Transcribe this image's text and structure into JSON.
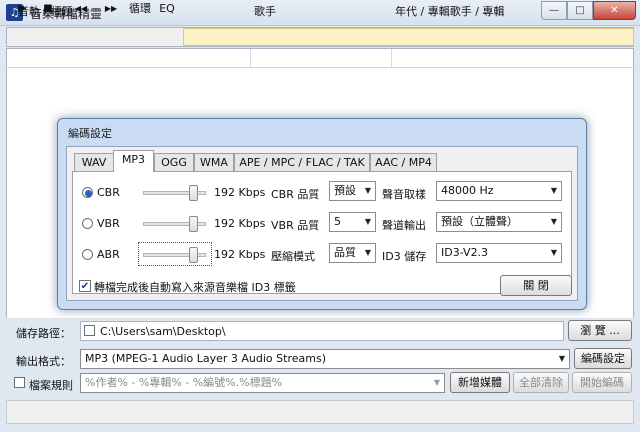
{
  "window": {
    "title": "音樂轉檔精靈",
    "icon": "music-note-icon"
  },
  "title_buttons": {
    "minimize": "—",
    "maximize": "□",
    "close": "✕"
  },
  "toolbar": {
    "play": "▶",
    "stop": "■",
    "prev": "◀◀",
    "next": "▶▶",
    "loop_label": "循環",
    "eq_label": "EQ"
  },
  "list": {
    "columns": [
      "音軌 / 標題",
      "歌手",
      "年代 / 專輯歌手 / 專輯"
    ]
  },
  "dialog": {
    "title": "編碼設定",
    "tabs": [
      "WAV",
      "MP3",
      "OGG",
      "WMA",
      "APE / MPC / FLAC / TAK",
      "AAC / MP4"
    ],
    "active_tab": "MP3",
    "rows": [
      {
        "mode": "CBR",
        "selected": true,
        "bitrate": "192 Kbps",
        "quality_label": "CBR 品質",
        "quality_value": "預設",
        "right_label": "聲音取樣",
        "right_value": "48000 Hz"
      },
      {
        "mode": "VBR",
        "selected": false,
        "bitrate": "192 Kbps",
        "quality_label": "VBR 品質",
        "quality_value": "5",
        "right_label": "聲道輸出",
        "right_value": "預設（立體聲）"
      },
      {
        "mode": "ABR",
        "selected": false,
        "bitrate": "192 Kbps",
        "quality_label": "壓縮模式",
        "quality_value": "品質",
        "right_label": "ID3 儲存",
        "right_value": "ID3-V2.3"
      }
    ],
    "slider_level": 0.85,
    "id3_checkbox_label": "轉檔完成後自動寫入來源音樂檔 ID3 標籤",
    "id3_checked": true,
    "close_button": "關 閉"
  },
  "bottom": {
    "save_path_label": "儲存路徑：",
    "save_path_value": "C:\\Users\\sam\\Desktop\\",
    "browse_button": "瀏 覽 ...",
    "output_format_label": "輸出格式：",
    "output_format_value": "MP3 (MPEG-1 Audio Layer 3 Audio Streams)",
    "encode_settings_button": "編碼設定",
    "naming_rule_label": "檔案規則",
    "naming_rule_value": "%作者% - %專輯% - %編號%.%標題%",
    "add_media_button": "新增媒體",
    "clear_all_button": "全部清除",
    "start_encode_button": "開始編碼"
  },
  "colors": {
    "accent": "#2563c9",
    "progress_bg": "#fcf3c4",
    "dialog_frame": "#c9dcf2"
  }
}
